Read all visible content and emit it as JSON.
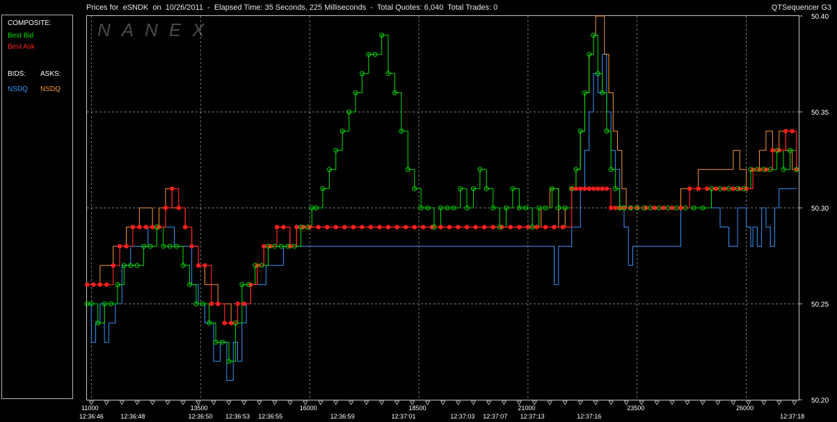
{
  "header": {
    "title": "Prices for  eSNDK  on  10/26/2011  -  Elapsed Time: 35 Seconds, 225 Milliseconds  -  Total Quotes: 6,040  Total Trades: 0",
    "app_name": "QTSequencer G3"
  },
  "watermark": "NANEX",
  "sidebar": {
    "composite_label": "COMPOSITE:",
    "best_bid_label": "Best Bid",
    "best_ask_label": "Best Ask",
    "bids_label": "BIDS:",
    "asks_label": "ASKS:",
    "bid_exchange": "NSDQ",
    "ask_exchange": "NSDQ"
  },
  "colors": {
    "best_bid": "#00e000",
    "best_ask": "#ff2020",
    "nsdq_bid": "#3399ff",
    "nsdq_ask": "#ff9933",
    "grid": "#b0b0b0",
    "frame": "#c8c8c8",
    "text": "#ffffff"
  },
  "chart_data": {
    "type": "line",
    "title": "Prices for  eSNDK  on  10/26/2011",
    "xlabel": "",
    "ylabel": "",
    "xlim": [
      10900,
      27200
    ],
    "ylim": [
      50.2,
      50.4
    ],
    "grid": true,
    "y_ticks": [
      "50.40",
      "50.35",
      "50.30",
      "50.25",
      "50.20"
    ],
    "x_ticks": [
      "11000",
      "13500",
      "16000",
      "18500",
      "21000",
      "23500",
      "26000"
    ],
    "time_labels": [
      {
        "seq": 11000,
        "label": "12:36:46"
      },
      {
        "seq": 11950,
        "label": "12:36:48"
      },
      {
        "seq": 13500,
        "label": "12:36:50"
      },
      {
        "seq": 14350,
        "label": "12:36:53"
      },
      {
        "seq": 15100,
        "label": "12:36:55"
      },
      {
        "seq": 16750,
        "label": "12:36:59"
      },
      {
        "seq": 18150,
        "label": "12:37:01"
      },
      {
        "seq": 19500,
        "label": "12:37:03"
      },
      {
        "seq": 20250,
        "label": "12:37:07"
      },
      {
        "seq": 21100,
        "label": "12:37:13"
      },
      {
        "seq": 22400,
        "label": "12:37:16"
      },
      {
        "seq": 27050,
        "label": "12:37:18"
      }
    ],
    "series": [
      {
        "name": "NSDQ",
        "side": "bid",
        "x": [
          10900,
          11000,
          11100,
          11200,
          11300,
          11400,
          11550,
          11700,
          11900,
          12100,
          12300,
          12500,
          12700,
          12900,
          13100,
          13300,
          13450,
          13600,
          13800,
          13950,
          14100,
          14250,
          14350,
          14450,
          14550,
          14650,
          14800,
          15000,
          15200,
          15400,
          15600,
          15800,
          16000,
          19000,
          21000,
          21500,
          21600,
          21700,
          22000,
          22200,
          22300,
          22400,
          22500,
          22600,
          22700,
          22800,
          22900,
          23000,
          23100,
          23200,
          23300,
          23400,
          23500,
          23600,
          23800,
          24000,
          24200,
          24500,
          24800,
          25000,
          25200,
          25400,
          25600,
          25800,
          26000,
          26100,
          26150,
          26250,
          26350,
          26450,
          26550,
          26650,
          26750,
          26850,
          26950,
          27050,
          27150
        ],
        "values": [
          50.25,
          50.23,
          50.24,
          50.25,
          50.23,
          50.24,
          50.25,
          50.27,
          50.28,
          50.28,
          50.29,
          50.29,
          50.29,
          50.28,
          50.28,
          50.26,
          50.25,
          50.24,
          50.22,
          50.23,
          50.21,
          50.23,
          50.22,
          50.24,
          50.25,
          50.26,
          50.26,
          50.27,
          50.27,
          50.28,
          50.28,
          50.28,
          50.28,
          50.28,
          50.28,
          50.28,
          50.26,
          50.28,
          50.29,
          50.31,
          50.33,
          50.35,
          50.37,
          50.36,
          50.38,
          50.35,
          50.33,
          50.32,
          50.3,
          50.29,
          50.27,
          50.28,
          50.28,
          50.28,
          50.28,
          50.28,
          50.28,
          50.3,
          50.3,
          50.3,
          50.3,
          50.29,
          50.28,
          50.3,
          50.29,
          50.28,
          50.29,
          50.28,
          50.3,
          50.29,
          50.28,
          50.3,
          50.31,
          50.31,
          50.31,
          50.31,
          50.31
        ]
      },
      {
        "name": "NSDQ",
        "side": "ask",
        "x": [
          10900,
          11050,
          11200,
          11350,
          11500,
          11650,
          11800,
          11950,
          12100,
          12250,
          12400,
          12550,
          12700,
          12850,
          13000,
          13150,
          13300,
          13450,
          13600,
          13750,
          13900,
          14050,
          14200,
          14350,
          14500,
          14650,
          14800,
          14950,
          15100,
          15250,
          15400,
          15550,
          15700,
          15850,
          16000,
          19000,
          21000,
          21300,
          21500,
          21700,
          21850,
          22000,
          22100,
          22200,
          22300,
          22400,
          22500,
          22550,
          22650,
          22750,
          22850,
          22950,
          23050,
          23150,
          23250,
          23350,
          23500,
          23700,
          23900,
          24100,
          24300,
          24500,
          24700,
          24900,
          25100,
          25300,
          25500,
          25700,
          25850,
          26000,
          26150,
          26300,
          26450,
          26600,
          26750,
          26900,
          27050,
          27150
        ],
        "values": [
          50.26,
          50.26,
          50.27,
          50.27,
          50.28,
          50.28,
          50.29,
          50.29,
          50.3,
          50.3,
          50.29,
          50.3,
          50.31,
          50.3,
          50.3,
          50.29,
          50.28,
          50.27,
          50.26,
          50.26,
          50.25,
          50.25,
          50.24,
          50.25,
          50.25,
          50.26,
          50.27,
          50.28,
          50.28,
          50.29,
          50.29,
          50.28,
          50.29,
          50.29,
          50.29,
          50.29,
          50.29,
          50.3,
          50.31,
          50.29,
          50.3,
          50.31,
          50.32,
          50.34,
          50.36,
          50.38,
          50.39,
          50.41,
          50.4,
          50.38,
          50.36,
          50.34,
          50.33,
          50.31,
          50.3,
          50.3,
          50.3,
          50.3,
          50.3,
          50.3,
          50.3,
          50.31,
          50.31,
          50.32,
          50.32,
          50.32,
          50.32,
          50.33,
          50.32,
          50.31,
          50.32,
          50.33,
          50.34,
          50.33,
          50.34,
          50.33,
          50.32,
          50.32
        ]
      },
      {
        "name": "Best Bid",
        "side": "bid",
        "x": [
          10900,
          11000,
          11150,
          11300,
          11450,
          11600,
          11750,
          11900,
          12050,
          12200,
          12350,
          12500,
          12650,
          12800,
          12950,
          13100,
          13250,
          13400,
          13550,
          13700,
          13850,
          14000,
          14150,
          14300,
          14450,
          14600,
          14750,
          14900,
          15050,
          15200,
          15350,
          15500,
          15650,
          15800,
          15950,
          16050,
          16150,
          16300,
          16450,
          16600,
          16750,
          16900,
          17050,
          17200,
          17350,
          17500,
          17650,
          17800,
          17950,
          18100,
          18250,
          18400,
          18550,
          18700,
          18850,
          19000,
          19150,
          19300,
          19450,
          19600,
          19750,
          19900,
          20050,
          20200,
          20350,
          20500,
          20650,
          20800,
          20950,
          21100,
          21250,
          21400,
          21550,
          21700,
          21850,
          22000,
          22100,
          22200,
          22300,
          22400,
          22500,
          22600,
          22700,
          22800,
          22900,
          23000,
          23100,
          23200,
          23350,
          23500,
          23650,
          23800,
          24000,
          24200,
          24400,
          24600,
          24800,
          25000,
          25200,
          25400,
          25600,
          25800,
          25950,
          26100,
          26250,
          26400,
          26550,
          26700,
          26850,
          27000,
          27150
        ],
        "values": [
          50.25,
          50.25,
          50.24,
          50.25,
          50.25,
          50.26,
          50.27,
          50.27,
          50.27,
          50.28,
          50.28,
          50.29,
          50.28,
          50.28,
          50.28,
          50.27,
          50.26,
          50.25,
          50.25,
          50.24,
          50.23,
          50.23,
          50.22,
          50.24,
          50.26,
          50.26,
          50.27,
          50.27,
          50.28,
          50.28,
          50.28,
          50.28,
          50.28,
          50.29,
          50.29,
          50.3,
          50.3,
          50.31,
          50.32,
          50.33,
          50.34,
          50.35,
          50.36,
          50.37,
          50.38,
          50.38,
          50.39,
          50.37,
          50.36,
          50.34,
          50.32,
          50.31,
          50.3,
          50.3,
          50.29,
          50.3,
          50.3,
          50.3,
          50.31,
          50.3,
          50.31,
          50.32,
          50.31,
          50.3,
          50.29,
          50.3,
          50.31,
          50.3,
          50.3,
          50.29,
          50.3,
          50.3,
          50.31,
          50.3,
          50.3,
          50.31,
          50.32,
          50.34,
          50.36,
          50.38,
          50.39,
          50.37,
          50.36,
          50.34,
          50.32,
          50.31,
          50.3,
          50.3,
          50.3,
          50.3,
          50.3,
          50.3,
          50.3,
          50.3,
          50.3,
          50.3,
          50.3,
          50.3,
          50.31,
          50.31,
          50.31,
          50.31,
          50.31,
          50.32,
          50.32,
          50.32,
          50.32,
          50.33,
          50.32,
          50.33,
          50.32
        ]
      },
      {
        "name": "Best Ask",
        "side": "ask",
        "x": [
          10900,
          11050,
          11200,
          11350,
          11500,
          11650,
          11800,
          11950,
          12100,
          12250,
          12400,
          12550,
          12700,
          12850,
          13000,
          13150,
          13300,
          13450,
          13600,
          13750,
          13900,
          14050,
          14200,
          14350,
          14500,
          14650,
          14800,
          14950,
          15100,
          15250,
          15400,
          15550,
          15700,
          15850,
          16000,
          16200,
          16400,
          16600,
          16800,
          17000,
          17200,
          17400,
          17600,
          17800,
          18000,
          18200,
          18400,
          18600,
          18800,
          19000,
          19200,
          19400,
          19600,
          19800,
          20000,
          20200,
          20400,
          20600,
          20800,
          21000,
          21200,
          21400,
          21600,
          21800,
          22000,
          22100,
          22200,
          22300,
          22400,
          22500,
          22600,
          22700,
          22800,
          22900,
          23000,
          23100,
          23200,
          23350,
          23500,
          23700,
          23900,
          24100,
          24300,
          24500,
          24700,
          24900,
          25100,
          25300,
          25500,
          25700,
          25850,
          26000,
          26150,
          26300,
          26450,
          26600,
          26750,
          26900,
          27050,
          27150
        ],
        "values": [
          50.26,
          50.26,
          50.26,
          50.26,
          50.27,
          50.28,
          50.28,
          50.29,
          50.29,
          50.29,
          50.29,
          50.29,
          50.3,
          50.31,
          50.3,
          50.29,
          50.28,
          50.27,
          50.27,
          50.25,
          50.25,
          50.24,
          50.24,
          50.25,
          50.25,
          50.26,
          50.27,
          50.28,
          50.28,
          50.29,
          50.29,
          50.28,
          50.29,
          50.29,
          50.29,
          50.29,
          50.29,
          50.29,
          50.29,
          50.29,
          50.29,
          50.29,
          50.29,
          50.29,
          50.29,
          50.29,
          50.29,
          50.29,
          50.29,
          50.29,
          50.29,
          50.29,
          50.29,
          50.29,
          50.29,
          50.29,
          50.29,
          50.29,
          50.29,
          50.29,
          50.29,
          50.29,
          50.29,
          50.29,
          50.31,
          50.31,
          50.31,
          50.31,
          50.31,
          50.31,
          50.31,
          50.31,
          50.31,
          50.3,
          50.3,
          50.3,
          50.3,
          50.3,
          50.3,
          50.3,
          50.3,
          50.3,
          50.3,
          50.3,
          50.31,
          50.31,
          50.31,
          50.31,
          50.31,
          50.31,
          50.31,
          50.31,
          50.32,
          50.32,
          50.32,
          50.33,
          50.33,
          50.34,
          50.34,
          50.32
        ]
      }
    ]
  }
}
